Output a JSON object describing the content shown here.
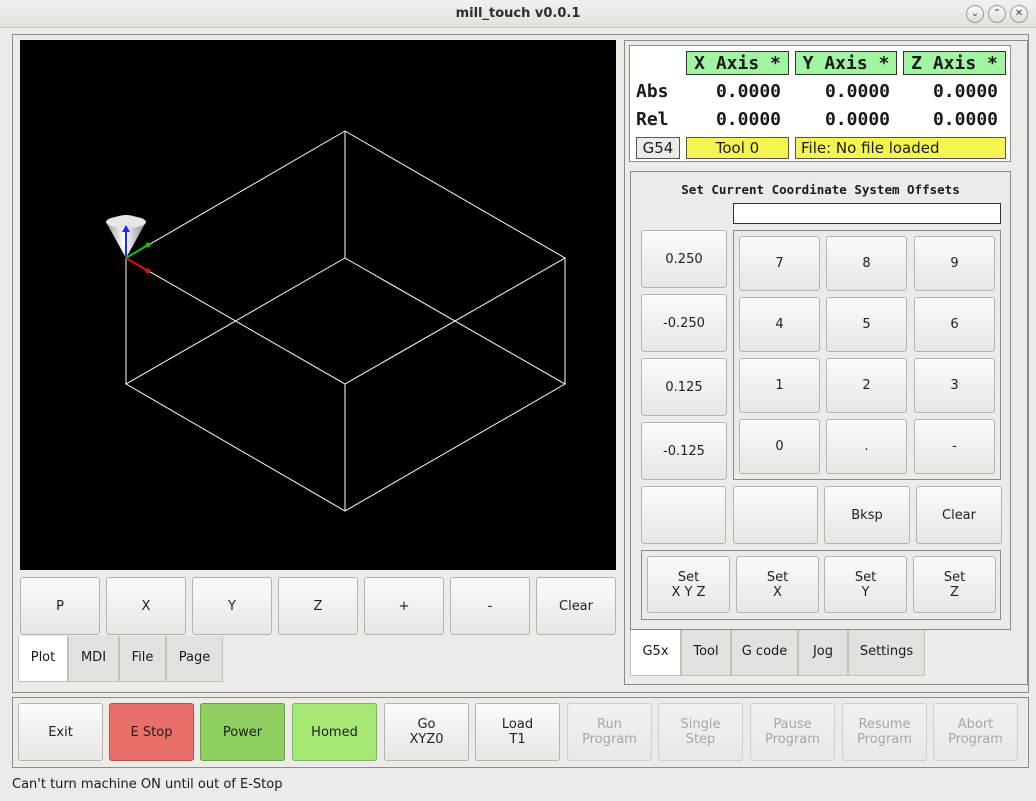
{
  "window": {
    "title": "mill_touch v0.0.1",
    "controls": [
      "minimize-icon",
      "maximize-icon",
      "close-icon"
    ]
  },
  "plot": {
    "background": "#000000",
    "buttons": [
      "P",
      "X",
      "Y",
      "Z",
      "+",
      "-",
      "Clear"
    ]
  },
  "left_tabs": [
    {
      "label": "Plot",
      "active": true
    },
    {
      "label": "MDI",
      "active": false
    },
    {
      "label": "File",
      "active": false
    },
    {
      "label": "Page",
      "active": false
    }
  ],
  "dro": {
    "axes": [
      "X Axis *",
      "Y Axis *",
      "Z Axis *"
    ],
    "rows": [
      {
        "label": "Abs",
        "values": [
          "0.0000",
          "0.0000",
          "0.0000"
        ]
      },
      {
        "label": "Rel",
        "values": [
          "0.0000",
          "0.0000",
          "0.0000"
        ]
      }
    ],
    "coord_system": "G54",
    "tool": "Tool 0",
    "file": "File: No file loaded",
    "header_color": "#a1f4a1",
    "info_color": "#f5f552"
  },
  "offsets": {
    "title": "Set Current Coordinate System Offsets",
    "entry_value": "",
    "increments": [
      "0.250",
      "-0.250",
      "0.125",
      "-0.125"
    ],
    "keypad": [
      "7",
      "8",
      "9",
      "4",
      "5",
      "6",
      "1",
      "2",
      "3",
      "0",
      ".",
      "-"
    ],
    "extra_buttons": [
      "",
      "",
      "Bksp",
      "Clear"
    ],
    "set_buttons": [
      {
        "line1": "Set",
        "line2": "X Y Z"
      },
      {
        "line1": "Set",
        "line2": "X"
      },
      {
        "line1": "Set",
        "line2": "Y"
      },
      {
        "line1": "Set",
        "line2": "Z"
      }
    ]
  },
  "right_tabs": [
    {
      "label": "G5x",
      "active": true
    },
    {
      "label": "Tool",
      "active": false
    },
    {
      "label": "G code",
      "active": false
    },
    {
      "label": "Jog",
      "active": false
    },
    {
      "label": "Settings",
      "active": false
    }
  ],
  "bottom_buttons": [
    {
      "line1": "Exit",
      "line2": "",
      "style": "normal"
    },
    {
      "line1": "E Stop",
      "line2": "",
      "style": "red",
      "color": "#e96f6b"
    },
    {
      "line1": "Power",
      "line2": "",
      "style": "green",
      "color": "#8fcf5f"
    },
    {
      "line1": "Homed",
      "line2": "",
      "style": "lgreen",
      "color": "#a6e874"
    },
    {
      "line1": "Go",
      "line2": "XYZ0",
      "style": "normal"
    },
    {
      "line1": "Load",
      "line2": "T1",
      "style": "normal"
    },
    {
      "line1": "Run",
      "line2": "Program",
      "style": "disabled"
    },
    {
      "line1": "Single",
      "line2": "Step",
      "style": "disabled"
    },
    {
      "line1": "Pause",
      "line2": "Program",
      "style": "disabled"
    },
    {
      "line1": "Resume",
      "line2": "Program",
      "style": "disabled"
    },
    {
      "line1": "Abort",
      "line2": "Program",
      "style": "disabled"
    }
  ],
  "status": "Can't turn machine ON until out of E-Stop"
}
